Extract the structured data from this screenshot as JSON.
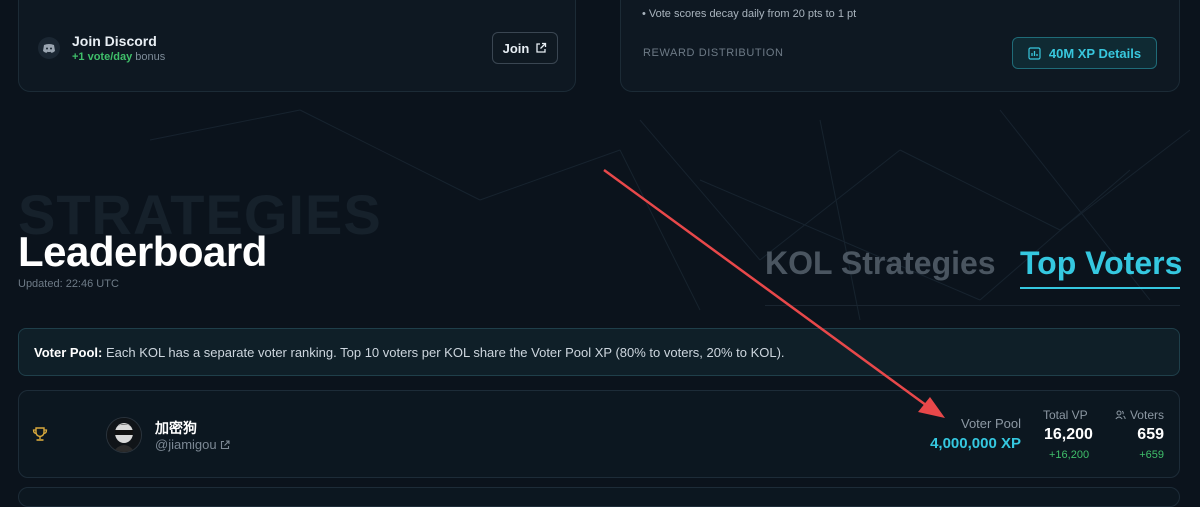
{
  "discord": {
    "title": "Join Discord",
    "bonus_highlight": "+1 vote/day",
    "bonus_suffix": " bonus",
    "join_label": "Join"
  },
  "reward": {
    "decay_note": "• Vote scores decay daily from 20 pts to 1 pt",
    "section_label": "REWARD DISTRIBUTION",
    "details_button": "40M XP Details"
  },
  "leaderboard": {
    "watermark": "STRATEGIES",
    "title": "Leaderboard",
    "updated": "Updated: 22:46 UTC",
    "tabs": [
      {
        "label": "KOL Strategies",
        "active": false
      },
      {
        "label": "Top Voters",
        "active": true
      }
    ],
    "info": {
      "label": "Voter Pool:",
      "text": " Each KOL has a separate voter ranking. Top 10 voters per KOL share the Voter Pool XP (80% to voters, 20% to KOL)."
    },
    "rows": [
      {
        "rank_icon": "trophy-icon",
        "name": "加密狗",
        "handle": "@jiamigou",
        "voter_pool_label": "Voter Pool",
        "voter_pool_value": "4,000,000 XP",
        "total_vp_label": "Total VP",
        "total_vp": "16,200",
        "total_vp_delta": "+16,200",
        "voters_label": "Voters",
        "voters": "659",
        "voters_delta": "+659"
      }
    ]
  },
  "colors": {
    "accent": "#35c8e0",
    "positive": "#3fbf6a",
    "annotation_arrow": "#e8484a",
    "background": "#0b131c"
  }
}
